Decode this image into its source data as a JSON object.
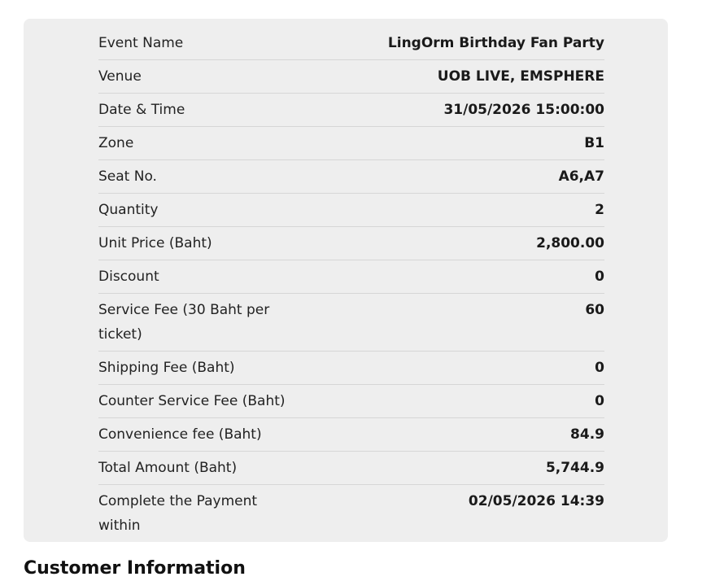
{
  "order_summary": {
    "rows": [
      {
        "label": "Event Name",
        "value": "LingOrm Birthday Fan Party"
      },
      {
        "label": "Venue",
        "value": "UOB LIVE, EMSPHERE"
      },
      {
        "label": "Date & Time",
        "value": "31/05/2026 15:00:00"
      },
      {
        "label": "Zone",
        "value": "B1"
      },
      {
        "label": "Seat No.",
        "value": "A6,A7"
      },
      {
        "label": "Quantity",
        "value": "2"
      },
      {
        "label": "Unit Price (Baht)",
        "value": "2,800.00"
      },
      {
        "label": "Discount",
        "value": "0"
      },
      {
        "label": "Service Fee (30 Baht per ticket)",
        "value": "60"
      },
      {
        "label": "Shipping Fee (Baht)",
        "value": "0"
      },
      {
        "label": "Counter Service Fee (Baht)",
        "value": "0"
      },
      {
        "label": "Convenience fee (Baht)",
        "value": "84.9"
      },
      {
        "label": "Total Amount (Baht)",
        "value": "5,744.9"
      },
      {
        "label": "Complete the Payment within",
        "value": "02/05/2026 14:39"
      }
    ]
  },
  "customer_section": {
    "title": "Customer Information"
  }
}
